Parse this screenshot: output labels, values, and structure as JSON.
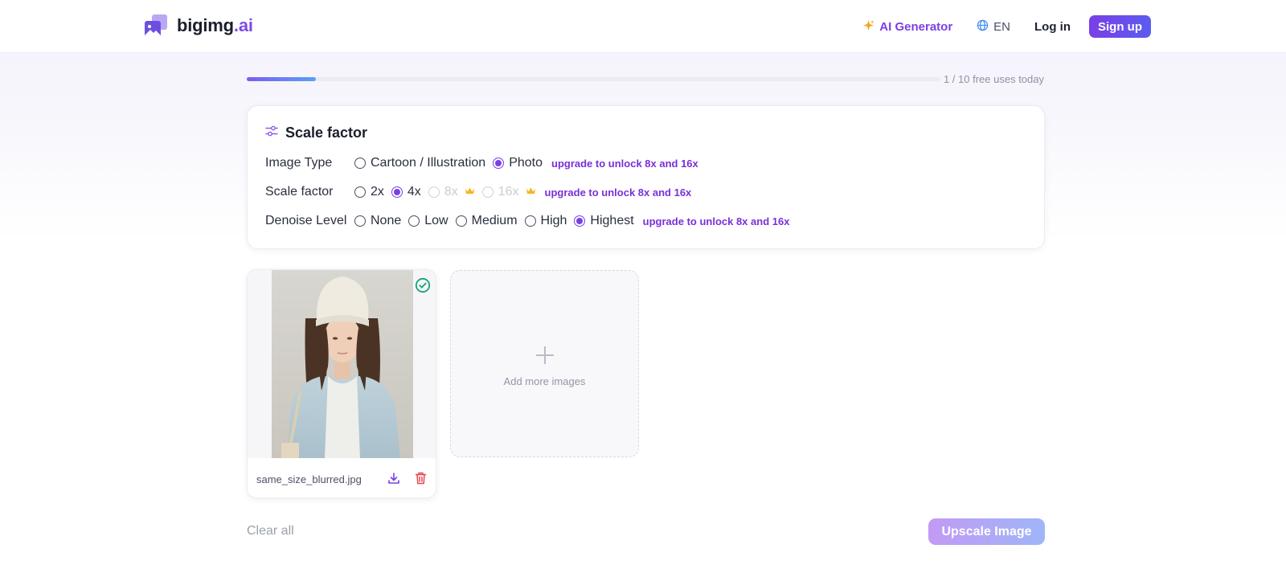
{
  "header": {
    "logo_main": "bigimg",
    "logo_accent": ".ai",
    "ai_generator": "AI Generator",
    "language": "EN",
    "login": "Log in",
    "signup": "Sign up"
  },
  "usage": {
    "label": "1 / 10 free uses today",
    "progress": 0.1
  },
  "settings": {
    "title": "Scale factor",
    "image_type": {
      "label": "Image Type",
      "options": [
        "Cartoon / Illustration",
        "Photo"
      ],
      "selected": "Photo",
      "upgrade": "upgrade to unlock 8x and 16x"
    },
    "scale_factor": {
      "label": "Scale factor",
      "options": [
        "2x",
        "4x",
        "8x",
        "16x"
      ],
      "selected": "4x",
      "locked": [
        "8x",
        "16x"
      ],
      "upgrade": "upgrade to unlock 8x and 16x"
    },
    "denoise": {
      "label": "Denoise Level",
      "options": [
        "None",
        "Low",
        "Medium",
        "High",
        "Highest"
      ],
      "selected": "Highest",
      "upgrade": "upgrade to unlock 8x and 16x"
    }
  },
  "images": [
    {
      "file_name": "same_size_blurred.jpg",
      "status": "done"
    }
  ],
  "add_more": "Add more images",
  "actions": {
    "clear_all": "Clear all",
    "upscale": "Upscale Image"
  },
  "colors": {
    "accent": "#7a3fe6",
    "upgrade_text": "#7a30d8",
    "success": "#16a37a",
    "delete": "#e5484d"
  }
}
